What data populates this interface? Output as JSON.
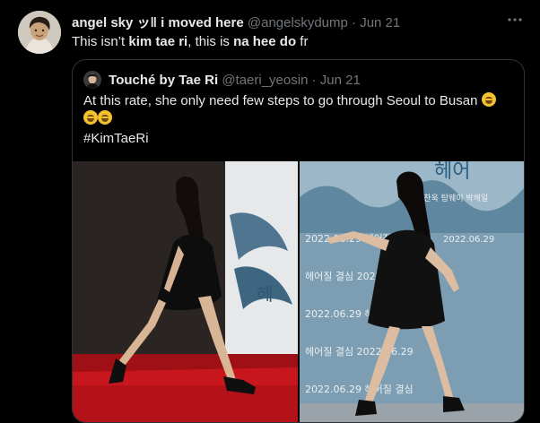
{
  "tweet": {
    "display_name": "angel sky ッ‖ i moved here",
    "handle": "@angelskydump",
    "separator": "·",
    "time": "Jun 21",
    "more_icon": "more-horizontal-icon",
    "text": {
      "part1": "This isn’t ",
      "bold1": "kim tae ri",
      "part2": ", this is ",
      "bold2": "na hee do",
      "part3": " fr"
    }
  },
  "quote": {
    "display_name": "Touché by Tae Ri",
    "handle": "@taeri_yeosin",
    "separator": "·",
    "time": "Jun 21",
    "text": "At this rate, she only need few steps to go through Seoul to Busan",
    "hashtag": "#KimTaeRi",
    "emoji_icon": "rolling-on-floor-laughing-emoji"
  },
  "media": {
    "left_photo": {
      "backdrop_text": "헤",
      "subject": "woman in black dress mid-stride on red carpet"
    },
    "right_photo": {
      "backdrop_rows": [
        "2022.06.29  헤어질 결심",
        "헤어질 결심  2022.06.29",
        "2022.06.29  헤어질 결심",
        "헤어질 결심  2022.06.29",
        "2022.06.29  헤어질 결심"
      ],
      "top_text": "헤어",
      "credits": "박찬욱  탕웨이  박해일",
      "date_top": "2022.06.29"
    }
  },
  "colors": {
    "background": "#000000",
    "text": "#e7e9ea",
    "muted": "#71767b",
    "border": "#2f3336",
    "carpet": "#c8161d",
    "backdrop_teal": "#6c8ea3"
  }
}
